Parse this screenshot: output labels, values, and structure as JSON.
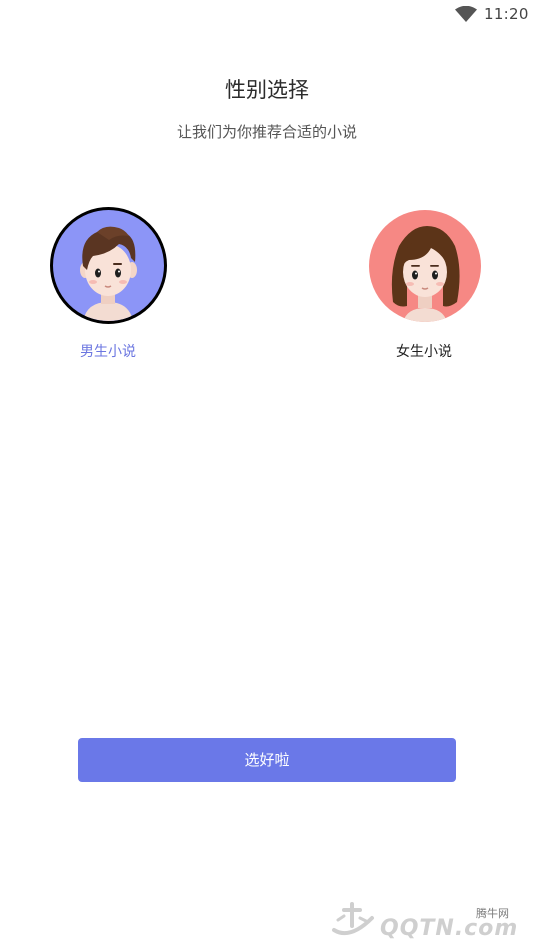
{
  "status_bar": {
    "time": "11:20",
    "wifi_icon": "wifi-icon"
  },
  "header": {
    "title": "性别选择",
    "subtitle": "让我们为你推荐合适的小说"
  },
  "options": {
    "male": {
      "label": "男生小说",
      "selected": true,
      "bg_color": "#8c95f7",
      "label_color": "#6b76e0"
    },
    "female": {
      "label": "女生小说",
      "selected": false,
      "bg_color": "#f68884",
      "label_color": "#222222"
    }
  },
  "confirm_button": {
    "label": "选好啦",
    "color": "#6a78e8"
  },
  "watermark": {
    "cn_text": "腾牛网",
    "en_text": "QQTN.com"
  }
}
